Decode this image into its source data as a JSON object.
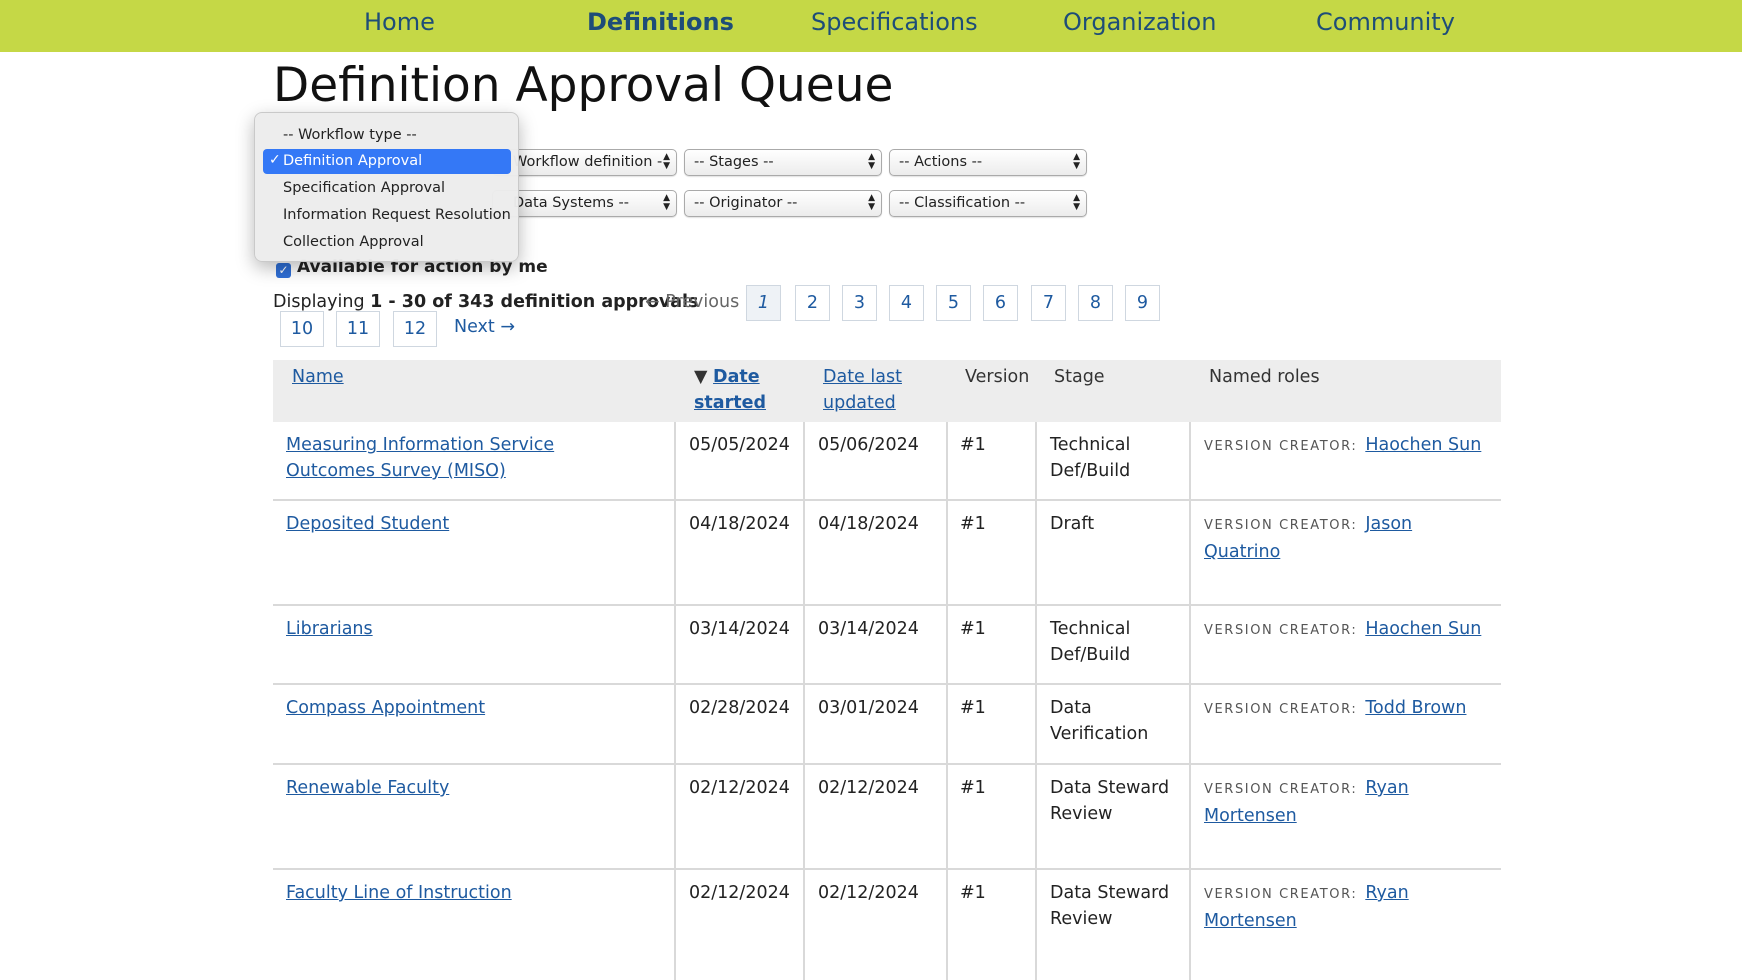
{
  "nav": {
    "items": [
      {
        "label": "Home"
      },
      {
        "label": "Definitions"
      },
      {
        "label": "Specifications"
      },
      {
        "label": "Organization"
      },
      {
        "label": "Community"
      }
    ]
  },
  "page": {
    "title": "Definition Approval Queue"
  },
  "filters": {
    "workflow_definition": "Workflow definition -",
    "stages": "-- Stages --",
    "actions": "-- Actions --",
    "data_systems": "Data Systems --",
    "originator": "-- Originator --",
    "classification": "-- Classification --"
  },
  "workflow_dropdown": {
    "options": [
      {
        "label": "-- Workflow type --",
        "selected": false
      },
      {
        "label": "Definition Approval",
        "selected": true
      },
      {
        "label": "Specification Approval",
        "selected": false
      },
      {
        "label": "Information Request Resolution",
        "selected": false
      },
      {
        "label": "Collection Approval",
        "selected": false
      }
    ],
    "check_mark": "✓"
  },
  "available_filter": {
    "label": "Available for action by me",
    "checked": true
  },
  "pagination": {
    "prefix": "Displaying ",
    "range": "1 - 30 of 343 definition approvals",
    "previous": "← Previous",
    "pages": [
      "1",
      "2",
      "3",
      "4",
      "5",
      "6",
      "7",
      "8",
      "9",
      "10",
      "11",
      "12"
    ],
    "current_page": "1",
    "next": "Next →"
  },
  "table": {
    "headers": {
      "name": "Name",
      "sort_indicator": "▼",
      "date_started": "Date started",
      "date_updated": "Date last updated",
      "version": "Version",
      "stage": "Stage",
      "named_roles": "Named roles"
    },
    "role_label": "VERSION CREATOR:",
    "rows": [
      {
        "name": "Measuring Information Service Outcomes Survey (MISO)",
        "started": "05/05/2024",
        "updated": "05/06/2024",
        "version": "#1",
        "stage": "Technical Def/Build",
        "creator": "Haochen Sun"
      },
      {
        "name": "Deposited Student",
        "started": "04/18/2024",
        "updated": "04/18/2024",
        "version": "#1",
        "stage": "Draft",
        "creator": "Jason Quatrino"
      },
      {
        "name": "Librarians",
        "started": "03/14/2024",
        "updated": "03/14/2024",
        "version": "#1",
        "stage": "Technical Def/Build",
        "creator": "Haochen Sun"
      },
      {
        "name": "Compass Appointment",
        "started": "02/28/2024",
        "updated": "03/01/2024",
        "version": "#1",
        "stage": "Data Verification",
        "creator": "Todd Brown"
      },
      {
        "name": "Renewable Faculty",
        "started": "02/12/2024",
        "updated": "02/12/2024",
        "version": "#1",
        "stage": "Data Steward Review",
        "creator": "Ryan Mortensen"
      },
      {
        "name": "Faculty Line of Instruction",
        "started": "02/12/2024",
        "updated": "02/12/2024",
        "version": "#1",
        "stage": "Data Steward Review",
        "creator": "Ryan Mortensen"
      }
    ]
  },
  "colors": {
    "nav_bg": "#c5d846",
    "link": "#1e5aa0",
    "nav_link": "#1e4d78",
    "selected_option": "#3478f6"
  }
}
